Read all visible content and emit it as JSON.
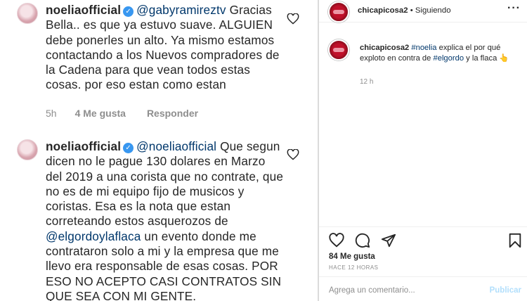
{
  "comments": [
    {
      "username": "noeliaofficial",
      "mention": "@gabyramireztv",
      "text": "Gracias Bella.. es que ya estuvo suave. ALGUIEN debe ponerles un alto. Ya mismo estamos contactando a los Nuevos compradores de la Cadena para que vean todos estas cosas. por eso estan como estan",
      "time": "5h",
      "likes": "4 Me gusta",
      "reply": "Responder"
    },
    {
      "username": "noeliaofficial",
      "mention": "@noeliaofficial",
      "text_before": "Que segun dicen no le pague 130 dolares en Marzo del 2019 a una corista que no contrate, que no es de mi equipo fijo de musicos y coristas. Esa es la nota que estan correteando estos asquerozos de",
      "inline_mention": "@elgordoylaflaca",
      "text_after": "un evento donde me contrataron solo a mi y la empresa que me llevo era responsable de esas cosas. POR ESO NO ACEPTO CASI CONTRATOS SIN QUE SEA CON MI GENTE."
    }
  ],
  "post": {
    "header": {
      "username": "chicapicosa2",
      "separator": " • ",
      "follow_status": "Siguiendo",
      "more": "···"
    },
    "caption": {
      "username": "chicapicosa2",
      "tag1": "#noelia",
      "text1": " explica el por qué exploto en contra de ",
      "tag2": "#elgordo",
      "text2": " y la flaca ",
      "emoji": "👆",
      "time": "12 h"
    },
    "likes": "84 Me gusta",
    "time_ago": "HACE 12 HORAS",
    "comment_placeholder": "Agrega un comentario...",
    "publish_label": "Publicar"
  },
  "icons": {
    "verified": "verified-badge-icon",
    "like": "heart-icon",
    "comment": "comment-icon",
    "share": "share-icon",
    "save": "bookmark-icon"
  },
  "colors": {
    "link": "#00376b",
    "verified": "#3897f0",
    "muted": "#8e8e8e",
    "publish": "#b2dffc"
  }
}
